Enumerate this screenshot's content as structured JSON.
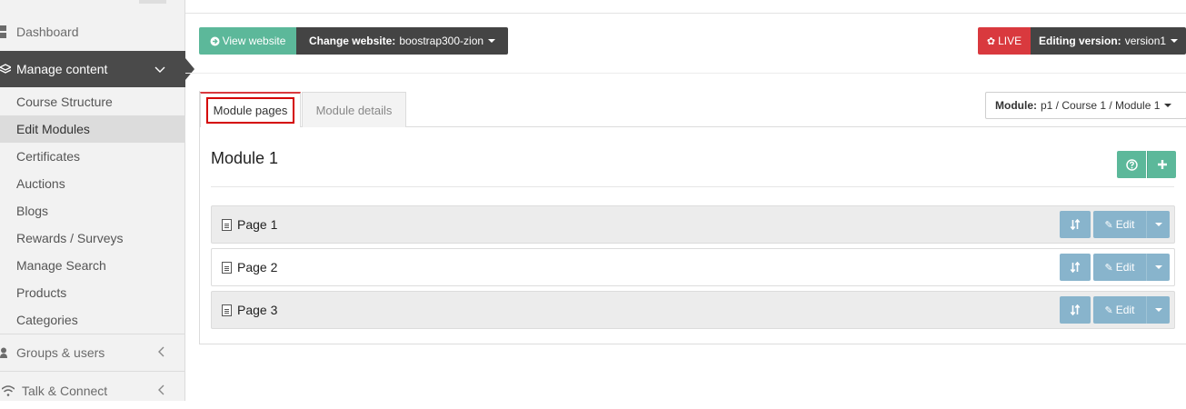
{
  "sidebar": {
    "items": [
      {
        "label": "Dashboard",
        "icon": "dashboard-icon"
      },
      {
        "label": "Manage content",
        "icon": "layers-icon",
        "chevron": "∨"
      },
      {
        "label": "Groups & users",
        "icon": "user-icon",
        "chevron": "<"
      },
      {
        "label": "Talk & Connect",
        "icon": "wifi-icon",
        "chevron": "<"
      }
    ],
    "sub_items": [
      {
        "label": "Course Structure"
      },
      {
        "label": "Edit Modules"
      },
      {
        "label": "Certificates"
      },
      {
        "label": "Auctions"
      },
      {
        "label": "Blogs"
      },
      {
        "label": "Rewards / Surveys"
      },
      {
        "label": "Manage Search"
      },
      {
        "label": "Products"
      },
      {
        "label": "Categories"
      }
    ]
  },
  "toolbar": {
    "view_website": "View website",
    "change_website_label": "Change website:",
    "change_website_value": "boostrap300-zion",
    "live_label": "LIVE",
    "version_label": "Editing version:",
    "version_value": "version1"
  },
  "tabs": [
    {
      "label": "Module pages"
    },
    {
      "label": "Module details"
    }
  ],
  "module_select": {
    "label": "Module:",
    "value": "p1 / Course 1 / Module 1"
  },
  "module": {
    "title": "Module 1",
    "pages": [
      {
        "title": "Page 1"
      },
      {
        "title": "Page 2"
      },
      {
        "title": "Page 3"
      }
    ],
    "edit_label": "Edit"
  },
  "colors": {
    "green": "#5cb89a",
    "dark": "#444444",
    "red": "#d9393e",
    "blue": "#88b4cc"
  }
}
